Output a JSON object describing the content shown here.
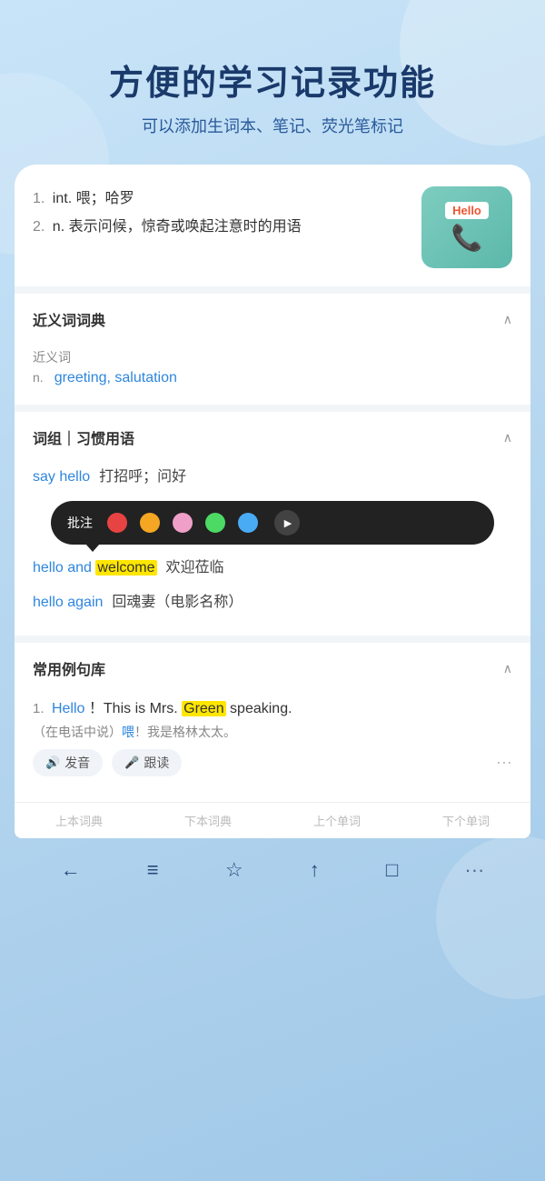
{
  "header": {
    "title": "方便的学习记录功能",
    "subtitle": "可以添加生词本、笔记、荧光笔标记"
  },
  "word_image": {
    "hello_label": "Hello",
    "phone_emoji": "📞"
  },
  "definitions": [
    {
      "num": "1.",
      "pos": "int.",
      "text": "喂；哈罗"
    },
    {
      "num": "2.",
      "pos": "n.",
      "text": "表示问候，惊奇或唤起注意时的用语"
    }
  ],
  "synonyms_section": {
    "title": "近义词词典",
    "syn_label": "近义词",
    "pos": "n.",
    "words": "greeting, salutation"
  },
  "phrases_section": {
    "title": "词组｜习惯用语",
    "items": [
      {
        "phrase": "say hello",
        "meaning": "打招呼；问好"
      },
      {
        "phrase": "hello and welcome",
        "meaning": "欢迎莅临",
        "highlight": "welcome"
      },
      {
        "phrase": "hello again",
        "meaning": "回魂妻（电影名称）"
      }
    ]
  },
  "annotation_toolbar": {
    "label": "批注",
    "colors": [
      "#e84343",
      "#f5a623",
      "#f0a0c8",
      "#4cd964",
      "#4aabf5"
    ],
    "play_title": "play"
  },
  "examples_section": {
    "title": "常用例句库",
    "items": [
      {
        "num": "1.",
        "en_parts": [
          "Hello",
          "！This is Mrs. ",
          "Green",
          " speaking."
        ],
        "cn": "（在电话中说）喂！我是格林太太。",
        "cn_highlighted": "喂",
        "audio_label": "发音",
        "read_label": "跟读"
      }
    ]
  },
  "bottom_nav": {
    "items": [
      "上本词典",
      "下本词典",
      "上个单词",
      "下个单词"
    ]
  },
  "system_nav": {
    "icons": [
      "←",
      "≡",
      "☆",
      "↑",
      "□",
      "···"
    ]
  }
}
